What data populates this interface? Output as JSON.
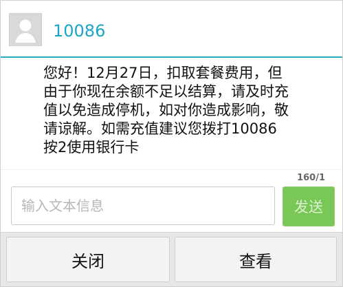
{
  "header": {
    "sender": "10086"
  },
  "message": {
    "text": "您好！12月27日，扣取套餐费用，但由于你现在余额不足以结算，请及时充值以免造成停机，如对你造成影响，敬请谅解。如需充值建议您拨打10086按2使用银行卡"
  },
  "composer": {
    "counter": "160/1",
    "placeholder": "输入文本信息",
    "send_label": "发送"
  },
  "actions": {
    "close_label": "关闭",
    "view_label": "查看"
  },
  "colors": {
    "accent": "#2aa9c7",
    "sender": "#1aa6c4",
    "send_button": "#79c857"
  },
  "icons": {
    "avatar": "person-icon"
  }
}
